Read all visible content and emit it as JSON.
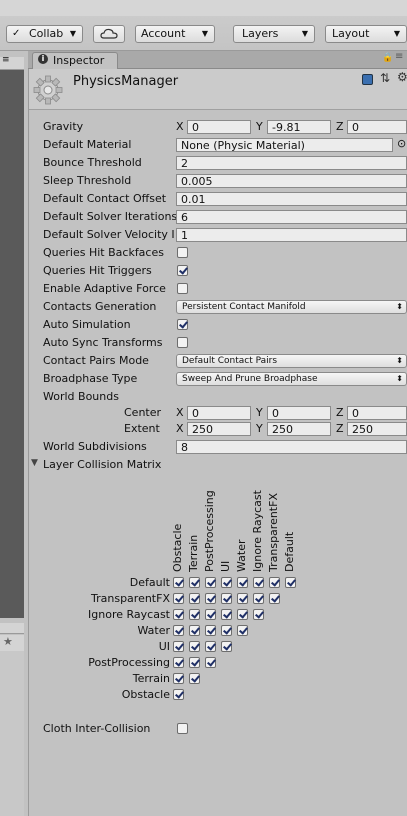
{
  "toolbar": {
    "collab_label": "Collab",
    "account_label": "Account",
    "layers_label": "Layers",
    "layout_label": "Layout"
  },
  "inspector": {
    "tab_label": "Inspector",
    "title": "PhysicsManager"
  },
  "gravity": {
    "label": "Gravity",
    "x": "0",
    "y": "-9.81",
    "z": "0"
  },
  "default_material": {
    "label": "Default Material",
    "value": "None (Physic Material)"
  },
  "bounce_threshold": {
    "label": "Bounce Threshold",
    "value": "2"
  },
  "sleep_threshold": {
    "label": "Sleep Threshold",
    "value": "0.005"
  },
  "default_contact_offset": {
    "label": "Default Contact Offset",
    "value": "0.01"
  },
  "default_solver_iterations": {
    "label": "Default Solver Iterations",
    "value": "6"
  },
  "default_solver_velocity": {
    "label": "Default Solver Velocity Ite",
    "value": "1"
  },
  "queries_hit_backfaces": {
    "label": "Queries Hit Backfaces",
    "checked": false
  },
  "queries_hit_triggers": {
    "label": "Queries Hit Triggers",
    "checked": true
  },
  "enable_adaptive_force": {
    "label": "Enable Adaptive Force",
    "checked": false
  },
  "contacts_generation": {
    "label": "Contacts Generation",
    "value": "Persistent Contact Manifold"
  },
  "auto_simulation": {
    "label": "Auto Simulation",
    "checked": true
  },
  "auto_sync_transforms": {
    "label": "Auto Sync Transforms",
    "checked": false
  },
  "contact_pairs_mode": {
    "label": "Contact Pairs Mode",
    "value": "Default Contact Pairs"
  },
  "broadphase_type": {
    "label": "Broadphase Type",
    "value": "Sweep And Prune Broadphase"
  },
  "world_bounds": {
    "label": "World Bounds",
    "center_label": "Center",
    "center": {
      "x": "0",
      "y": "0",
      "z": "0"
    },
    "extent_label": "Extent",
    "extent": {
      "x": "250",
      "y": "250",
      "z": "250"
    }
  },
  "world_subdivisions": {
    "label": "World Subdivisions",
    "value": "8"
  },
  "collision_matrix": {
    "label": "Layer Collision Matrix",
    "columns": [
      "Obstacle",
      "Terrain",
      "PostProcessing",
      "UI",
      "Water",
      "Ignore Raycast",
      "TransparentFX",
      "Default"
    ],
    "rows": [
      "Default",
      "TransparentFX",
      "Ignore Raycast",
      "Water",
      "UI",
      "PostProcessing",
      "Terrain",
      "Obstacle"
    ]
  },
  "cloth_inter_collision": {
    "label": "Cloth Inter-Collision",
    "checked": false
  },
  "axis_labels": {
    "x": "X",
    "y": "Y",
    "z": "Z"
  }
}
